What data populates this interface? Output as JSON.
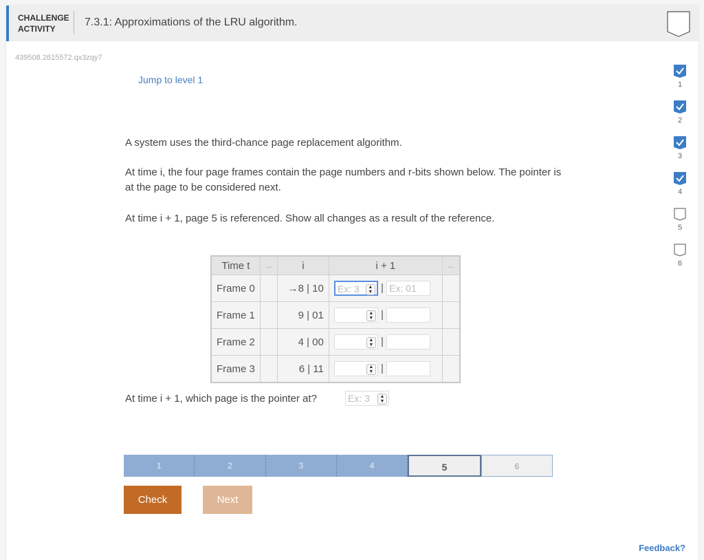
{
  "header": {
    "label_line1": "CHALLENGE",
    "label_line2": "ACTIVITY",
    "title": "7.3.1: Approximations of the LRU algorithm."
  },
  "activity_code": "439508.2615572.qx3zqy7",
  "jump_link": "Jump to level 1",
  "paragraphs": [
    "A system uses the third-chance page replacement algorithm.",
    "At time i, the four page frames contain the page numbers and r-bits shown below. The pointer is at the page to be considered next.",
    "At time i + 1, page 5 is referenced. Show all changes as a result of the reference."
  ],
  "table": {
    "headers": [
      "Time t",
      "...",
      "i",
      "i + 1",
      "..."
    ],
    "rows": [
      {
        "label": "Frame 0",
        "value": "→8 | 10",
        "page_placeholder": "Ex: 3",
        "bits_placeholder": "Ex: 01"
      },
      {
        "label": "Frame 1",
        "value": "9 | 01",
        "page_placeholder": "",
        "bits_placeholder": ""
      },
      {
        "label": "Frame 2",
        "value": "4 | 00",
        "page_placeholder": "",
        "bits_placeholder": ""
      },
      {
        "label": "Frame 3",
        "value": "6 | 11",
        "page_placeholder": "",
        "bits_placeholder": ""
      }
    ],
    "separator": "|"
  },
  "pointer_question": "At time i + 1, which page is the pointer at?",
  "pointer_placeholder": "Ex: 3",
  "levels": [
    {
      "n": "1",
      "done": true
    },
    {
      "n": "2",
      "done": true
    },
    {
      "n": "3",
      "done": true
    },
    {
      "n": "4",
      "done": true
    },
    {
      "n": "5",
      "done": false
    },
    {
      "n": "6",
      "done": false
    }
  ],
  "progress": {
    "segments": [
      "1",
      "2",
      "3",
      "4",
      "5",
      "6"
    ],
    "current": "5",
    "completed": 4
  },
  "buttons": {
    "check": "Check",
    "next": "Next"
  },
  "feedback": "Feedback?",
  "colors": {
    "accent": "#3c7dc6",
    "check": "#c26b26",
    "next": "#e0b796",
    "progress_done": "#8fadd2"
  }
}
